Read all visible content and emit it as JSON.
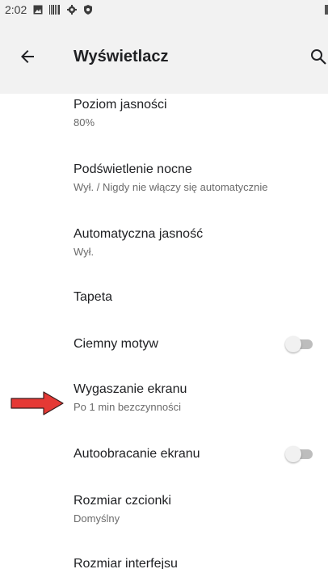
{
  "status_bar": {
    "time": "2:02",
    "icons": [
      "image-icon",
      "barcode-icon",
      "gear-icon",
      "shield-icon"
    ]
  },
  "app_bar": {
    "title": "Wyświetlacz",
    "back_icon": "arrow-left-icon",
    "search_icon": "search-icon"
  },
  "settings": [
    {
      "title": "Poziom jasności",
      "subtitle": "80%"
    },
    {
      "title": "Podświetlenie nocne",
      "subtitle": "Wył. / Nigdy nie włączy się automatycznie"
    },
    {
      "title": "Automatyczna jasność",
      "subtitle": "Wył."
    },
    {
      "title": "Tapeta"
    },
    {
      "title": "Ciemny motyw",
      "toggle": "off"
    },
    {
      "title": "Wygaszanie ekranu",
      "subtitle": "Po 1 min bezczynności"
    },
    {
      "title": "Autoobracanie ekranu",
      "toggle": "off"
    },
    {
      "title": "Rozmiar czcionki",
      "subtitle": "Domyślny"
    },
    {
      "title": "Rozmiar interfejsu"
    }
  ],
  "colors": {
    "app_bar_bg": "#f2f2f2",
    "annotation_arrow": "#e53935"
  }
}
